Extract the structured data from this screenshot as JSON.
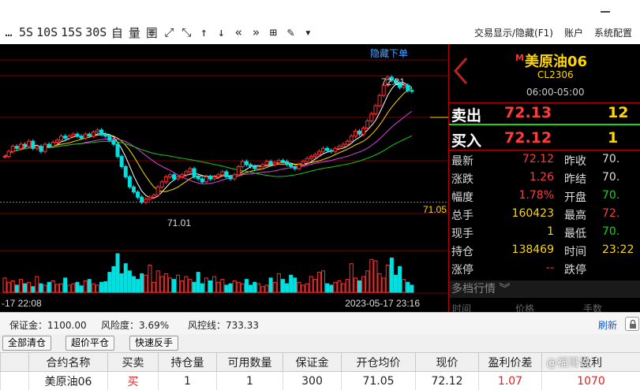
{
  "toolbar": {
    "icons": [
      {
        "name": "period-1min-button",
        "glyph": "…"
      },
      {
        "name": "period-5s-button",
        "glyph": "5S"
      },
      {
        "name": "period-10s-button",
        "glyph": "10S"
      },
      {
        "name": "period-15s-button",
        "glyph": "15S"
      },
      {
        "name": "period-30s-button",
        "glyph": "30S"
      },
      {
        "name": "custom-period-button",
        "glyph": "自"
      },
      {
        "name": "volume-toggle-button",
        "glyph": "量"
      },
      {
        "name": "fullscreen-chart-button",
        "glyph": "圛"
      },
      {
        "name": "expand-icon",
        "glyph": "⤢"
      },
      {
        "name": "shrink-icon",
        "glyph": "⤡"
      },
      {
        "name": "arrow-up-icon",
        "glyph": "↑"
      },
      {
        "name": "arrow-down-icon",
        "glyph": "↓"
      },
      {
        "name": "double-left-icon",
        "glyph": "«"
      },
      {
        "name": "double-right-icon",
        "glyph": "»"
      },
      {
        "name": "grid-icon",
        "glyph": "⊞"
      },
      {
        "name": "draw-pen-icon",
        "glyph": "✎"
      },
      {
        "name": "dropdown-caret-icon",
        "glyph": "▾"
      }
    ],
    "menu": [
      "交易显示/隐藏(F1)",
      "账户",
      "系统配置"
    ]
  },
  "chart": {
    "hide_order_label": "隐藏下单",
    "high_label": "72.31",
    "low_label": "71.01",
    "price_line_label": "71.05",
    "time_left": "-17 22:08",
    "time_right": "2023-05-17 23:16",
    "chart_data": {
      "type": "candlestick",
      "ylim": [
        70.9,
        72.45
      ],
      "price_line": 71.05,
      "closes": [
        71.5,
        71.55,
        71.6,
        71.58,
        71.62,
        71.6,
        71.65,
        71.58,
        71.6,
        71.55,
        71.62,
        71.6,
        71.64,
        71.66,
        71.7,
        71.68,
        71.7,
        71.72,
        71.7,
        71.68,
        71.72,
        71.7,
        71.74,
        71.76,
        71.72,
        71.7,
        71.66,
        71.62,
        71.5,
        71.4,
        71.3,
        71.2,
        71.15,
        71.1,
        71.05,
        71.08,
        71.1,
        71.12,
        71.2,
        71.25,
        71.3,
        71.32,
        71.28,
        71.3,
        71.32,
        71.35,
        71.38,
        71.3,
        71.28,
        71.25,
        71.3,
        71.28,
        71.3,
        71.32,
        71.35,
        71.3,
        71.28,
        71.32,
        71.4,
        71.45,
        71.42,
        71.4,
        71.38,
        71.4,
        71.42,
        71.45,
        71.42,
        71.44,
        71.46,
        71.45,
        71.42,
        71.4,
        71.38,
        71.42,
        71.45,
        71.48,
        71.5,
        71.52,
        71.55,
        71.58,
        71.56,
        71.55,
        71.58,
        71.6,
        71.62,
        71.65,
        71.7,
        71.75,
        71.72,
        71.78,
        71.85,
        71.92,
        72.0,
        72.1,
        72.2,
        72.28,
        72.25,
        72.22,
        72.18,
        72.2,
        72.15,
        72.14
      ],
      "volume": [
        20,
        14,
        16,
        10,
        18,
        12,
        14,
        8,
        22,
        12,
        10,
        14,
        16,
        11,
        12,
        20,
        10,
        12,
        14,
        9,
        16,
        18,
        12,
        10,
        14,
        15,
        28,
        36,
        54,
        26,
        40,
        30,
        22,
        18,
        26,
        24,
        38,
        14,
        30,
        22,
        26,
        20,
        18,
        24,
        16,
        22,
        18,
        14,
        28,
        12,
        20,
        16,
        22,
        14,
        18,
        10,
        12,
        16,
        14,
        12,
        18,
        10,
        14,
        12,
        8,
        10,
        20,
        14,
        26,
        18,
        12,
        24,
        20,
        14,
        10,
        12,
        22,
        18,
        28,
        30,
        12,
        10,
        14,
        16,
        12,
        18,
        40,
        20,
        16,
        22,
        30,
        46,
        44,
        26,
        20,
        38,
        48,
        24,
        36,
        18,
        14,
        10
      ]
    }
  },
  "quote": {
    "flag": "M",
    "name": "美原油06",
    "code": "CL2306",
    "hours": "06:00-05:00",
    "sell_label": "卖出",
    "sell_price": "72.13",
    "sell_vol": "12",
    "buy_label": "买入",
    "buy_price": "72.12",
    "buy_vol": "1",
    "rows": [
      {
        "l1": "最新",
        "v1": "72.12",
        "c1": "red",
        "l2": "昨收",
        "v2": "70."
      },
      {
        "l1": "涨跌",
        "v1": "1.26",
        "c1": "red",
        "l2": "昨结",
        "v2": "70."
      },
      {
        "l1": "幅度",
        "v1": "1.78%",
        "c1": "red",
        "l2": "开盘",
        "v2": "70."
      },
      {
        "l1": "总手",
        "v1": "160423",
        "c1": "yel",
        "l2": "最高",
        "v2": "72."
      },
      {
        "l1": "现手",
        "v1": "1",
        "c1": "yel",
        "l2": "最低",
        "v2": "70."
      },
      {
        "l1": "持仓",
        "v1": "138469",
        "c1": "yel",
        "l2": "时间",
        "v2": "23:22"
      },
      {
        "l1": "涨停",
        "v1": "--",
        "c1": "red",
        "l2": "跌停",
        "v2": ""
      }
    ],
    "depth_title": "多档行情",
    "depth_cols": [
      "时间",
      "价格",
      "手数"
    ]
  },
  "risk": {
    "margin": "保证金：1100.00",
    "risk_degree": "风险度：3.69%",
    "risk_line": "风控线：733.33",
    "refresh": "刷新"
  },
  "actions": [
    "全部清仓",
    "超价平仓",
    "快速反手"
  ],
  "positions": {
    "columns": [
      "合约名称",
      "买卖",
      "持仓量",
      "可用数量",
      "保证金",
      "开仓均价",
      "现价",
      "盈利价差",
      "盈利"
    ],
    "rows": [
      [
        "美原油06",
        "买",
        "1",
        "1",
        "300",
        "71.05",
        "72.12",
        "1.07",
        "1070"
      ]
    ]
  },
  "watermark": "@福哥说"
}
